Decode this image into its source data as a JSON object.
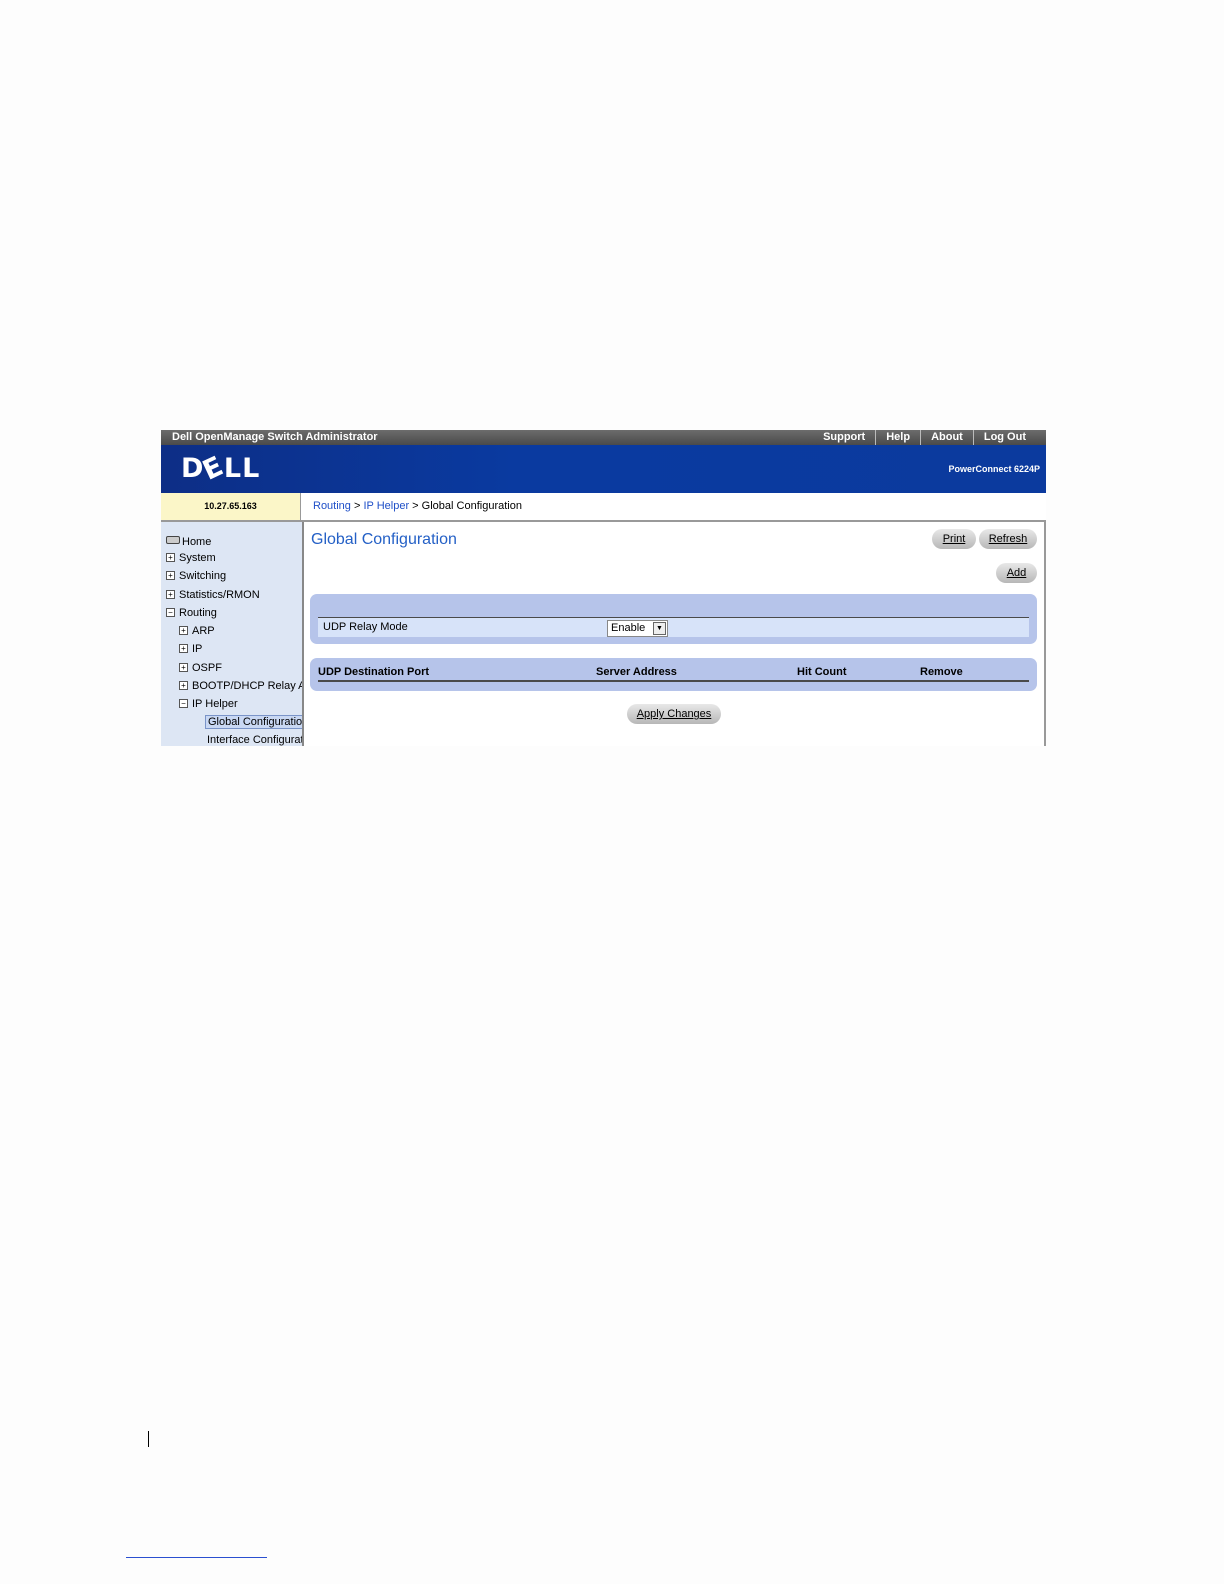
{
  "window": {
    "app_title": "Dell OpenManage Switch Administrator",
    "top_links": [
      "Support",
      "Help",
      "About",
      "Log Out"
    ],
    "logo_text": "DELL",
    "product": "PowerConnect 6224P",
    "ip_address": "10.27.65.163"
  },
  "breadcrumb": {
    "item1": "Routing",
    "sep1": " > ",
    "item2": "IP Helper",
    "sep2": " > ",
    "current": "Global Configuration"
  },
  "sidebar": {
    "home": "Home",
    "system": "System",
    "switching": "Switching",
    "statistics": "Statistics/RMON",
    "routing": "Routing",
    "arp": "ARP",
    "ip": "IP",
    "ospf": "OSPF",
    "bootp": "BOOTP/DHCP Relay Agent",
    "ip_helper": "IP Helper",
    "global_config": "Global Configuration",
    "interface_config": "Interface Configuration"
  },
  "main": {
    "title": "Global Configuration",
    "print_label": "Print",
    "refresh_label": "Refresh",
    "add_label": "Add",
    "udp_relay_label": "UDP Relay Mode",
    "udp_relay_value": "Enable",
    "table_headers": [
      "UDP Destination Port",
      "Server Address",
      "Hit Count",
      "Remove"
    ],
    "apply_label": "Apply Changes"
  }
}
